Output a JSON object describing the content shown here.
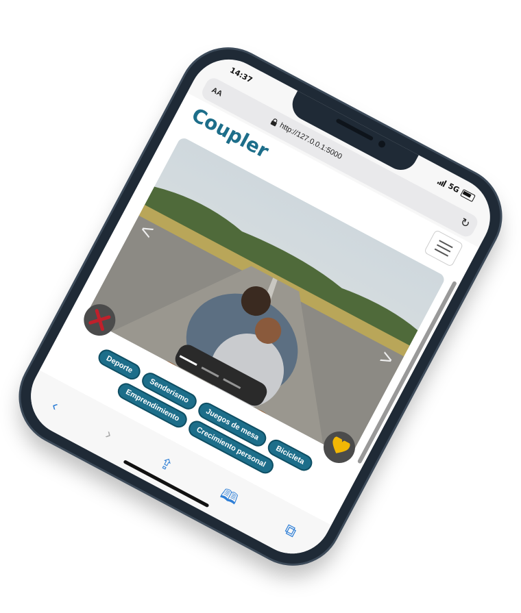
{
  "status": {
    "time": "14:37",
    "network": "5G"
  },
  "browser": {
    "text_size": "AA",
    "url": "http://127.0.0.1:5000"
  },
  "app": {
    "brand": "Coupler"
  },
  "card": {
    "prev": "<",
    "next": ">",
    "slides": 3,
    "current": 1
  },
  "actions": {
    "dislike": "✕",
    "like": "♥"
  },
  "tags": [
    "Deporte",
    "Senderismo",
    "Juegos de mesa",
    "Bicicleta",
    "Emprendimiento",
    "Crecimiento personal"
  ],
  "toolbar": {
    "back": "‹",
    "forward": "›",
    "share": "⇪",
    "bookmarks": "🕮",
    "tabs": "⧉"
  },
  "colors": {
    "brand": "#1d6e8a",
    "dislike": "#c0202b",
    "like": "#f2b705"
  }
}
